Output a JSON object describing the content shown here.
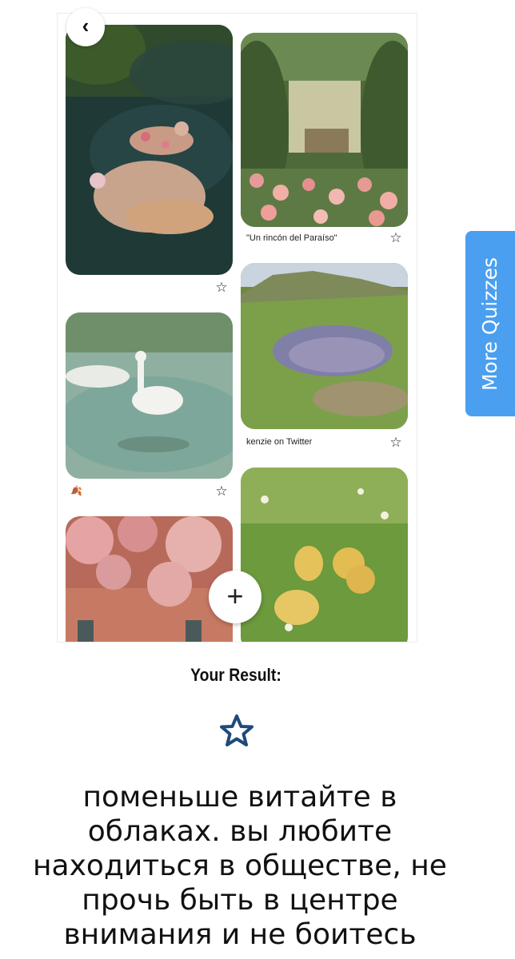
{
  "board": {
    "pins": [
      {
        "id": "pin-ophelia",
        "caption": ""
      },
      {
        "id": "pin-garden",
        "caption": "\"Un rincón del Paraíso\""
      },
      {
        "id": "pin-swan",
        "caption": ""
      },
      {
        "id": "pin-lake",
        "caption": "kenzie on Twitter"
      },
      {
        "id": "pin-building",
        "caption": ""
      },
      {
        "id": "pin-ducklings",
        "caption": ""
      }
    ],
    "icons": {
      "back": "chevron-left-icon",
      "add": "plus-icon",
      "save": "star-outline-icon",
      "leaf": "leaf-icon"
    },
    "back_glyph": "‹",
    "add_glyph": "+",
    "star_glyph": "☆",
    "leaf_glyph": "🍂"
  },
  "more_quizzes": {
    "label": "More Quizzes",
    "color": "#4a9ff0"
  },
  "result": {
    "label": "Your Result:",
    "star_icon": "star-icon",
    "star_color": "#1e4a7a",
    "text": "поменьше витайте в облаках. вы любите находиться в обществе, не прочь быть в центре внимания и не боитесь"
  }
}
